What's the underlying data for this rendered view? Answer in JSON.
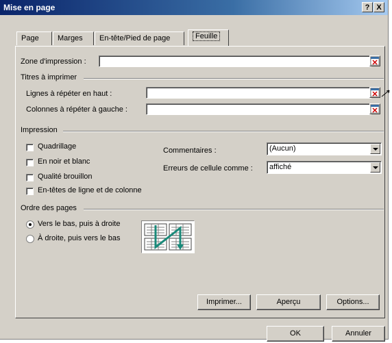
{
  "window": {
    "title": "Mise en page",
    "help_label": "?",
    "close_label": "X"
  },
  "tabs": [
    {
      "label": "Page"
    },
    {
      "label": "Marges"
    },
    {
      "label": "En-tête/Pied de page"
    },
    {
      "label": "Feuille",
      "active": true
    }
  ],
  "print_area": {
    "label": "Zone d'impression :",
    "value": ""
  },
  "print_titles": {
    "group_label": "Titres à imprimer",
    "rows_label": "Lignes à répéter en haut :",
    "rows_value": "",
    "cols_label": "Colonnes à répéter à gauche :",
    "cols_value": ""
  },
  "printing": {
    "group_label": "Impression",
    "checkboxes": [
      {
        "label": "Quadrillage",
        "checked": false
      },
      {
        "label": "En noir et blanc",
        "checked": false
      },
      {
        "label": "Qualité brouillon",
        "checked": false
      },
      {
        "label": "En-têtes de ligne et de colonne",
        "checked": false
      }
    ],
    "comments_label": "Commentaires :",
    "comments_value": "(Aucun)",
    "errors_label": "Erreurs de cellule comme :",
    "errors_value": "affiché"
  },
  "page_order": {
    "group_label": "Ordre des pages",
    "option_down": "Vers le bas, puis à droite",
    "option_over": "À droite, puis vers le bas",
    "selected": "down"
  },
  "buttons": {
    "print": "Imprimer...",
    "preview": "Aperçu",
    "options": "Options...",
    "ok": "OK",
    "cancel": "Annuler"
  },
  "colors": {
    "title_start": "#0a246a",
    "title_end": "#a6caf0",
    "dialog_bg": "#d4d0c8",
    "order_arrow": "#1a8a7a"
  },
  "icons": {
    "range_selector": "collapse-dialog-icon",
    "page_order_preview": "page-order-down-then-over-icon"
  }
}
